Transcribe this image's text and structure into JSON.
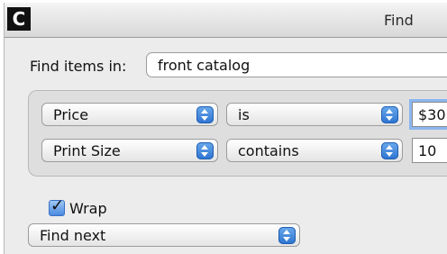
{
  "figure_label": "C",
  "window": {
    "title": "Find"
  },
  "scope": {
    "label": "Find items in:",
    "value": "front catalog"
  },
  "criteria": [
    {
      "field": "Price",
      "operator": "is",
      "value": "$30"
    },
    {
      "field": "Print Size",
      "operator": "contains",
      "value": "10"
    }
  ],
  "options": {
    "wrap_label": "Wrap",
    "wrap_checked": true
  },
  "action": {
    "selected": "Find next"
  },
  "colors": {
    "accent": "#2d73d1",
    "focus_ring": "#8bb6ef",
    "background": "#ececec"
  }
}
